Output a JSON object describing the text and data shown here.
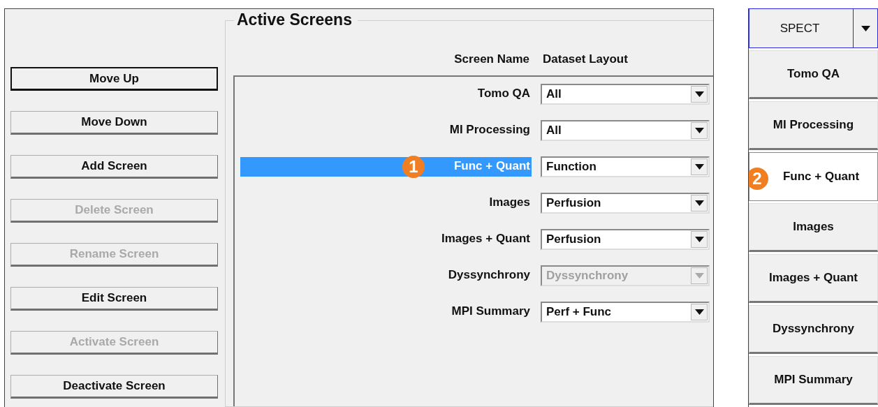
{
  "buttons": [
    {
      "label": "Move Up",
      "disabled": false,
      "default": true
    },
    {
      "label": "Move Down",
      "disabled": false,
      "default": false
    },
    {
      "label": "Add Screen",
      "disabled": false,
      "default": false
    },
    {
      "label": "Delete Screen",
      "disabled": true,
      "default": false
    },
    {
      "label": "Rename Screen",
      "disabled": true,
      "default": false
    },
    {
      "label": "Edit Screen",
      "disabled": false,
      "default": false
    },
    {
      "label": "Activate Screen",
      "disabled": true,
      "default": false
    },
    {
      "label": "Deactivate Screen",
      "disabled": false,
      "default": false
    }
  ],
  "active_screens": {
    "title": "Active Screens",
    "columns": [
      "Screen Name",
      "Dataset Layout"
    ],
    "rows": [
      {
        "name": "Tomo QA",
        "layout": "All",
        "selected": false,
        "disabled": false
      },
      {
        "name": "MI Processing",
        "layout": "All",
        "selected": false,
        "disabled": false
      },
      {
        "name": "Func + Quant",
        "layout": "Function",
        "selected": true,
        "disabled": false,
        "callout": "1"
      },
      {
        "name": "Images",
        "layout": "Perfusion",
        "selected": false,
        "disabled": false
      },
      {
        "name": "Images + Quant",
        "layout": "Perfusion",
        "selected": false,
        "disabled": false
      },
      {
        "name": "Dyssynchrony",
        "layout": "Dyssynchrony",
        "selected": false,
        "disabled": true
      },
      {
        "name": "MPI Summary",
        "layout": "Perf + Func",
        "selected": false,
        "disabled": false
      }
    ]
  },
  "mode_dropdown": {
    "value": "SPECT"
  },
  "screen_tabs": [
    {
      "label": "Tomo QA",
      "selected": false
    },
    {
      "label": "MI Processing",
      "selected": false
    },
    {
      "label": "Func + Quant",
      "selected": true,
      "callout": "2"
    },
    {
      "label": "Images",
      "selected": false
    },
    {
      "label": "Images + Quant",
      "selected": false
    },
    {
      "label": "Dyssynchrony",
      "selected": false
    },
    {
      "label": "MPI Summary",
      "selected": false
    }
  ]
}
